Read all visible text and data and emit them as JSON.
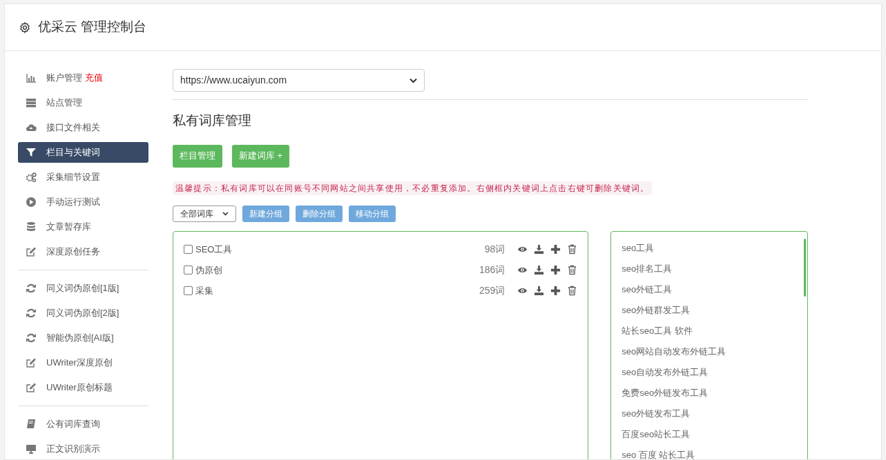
{
  "header": {
    "title": "优采云 管理控制台"
  },
  "sidebar": {
    "sections": [
      {
        "items": [
          {
            "label": "账户管理",
            "badge": "充值",
            "kind": "chart",
            "selected": false
          },
          {
            "label": "站点管理",
            "kind": "server",
            "selected": false
          },
          {
            "label": "接口文件相关",
            "kind": "cloud",
            "selected": false
          },
          {
            "label": "栏目与关键词",
            "kind": "filter",
            "selected": true
          },
          {
            "label": "采集细节设置",
            "kind": "gears",
            "selected": false
          },
          {
            "label": "手动运行测试",
            "kind": "play",
            "selected": false
          },
          {
            "label": "文章暂存库",
            "kind": "database",
            "selected": false
          },
          {
            "label": "深度原创任务",
            "kind": "edit",
            "selected": false
          }
        ]
      },
      {
        "items": [
          {
            "label": "同义词伪原创[1版]",
            "kind": "refresh",
            "selected": false
          },
          {
            "label": "同义词伪原创[2版]",
            "kind": "refresh",
            "selected": false
          },
          {
            "label": "智能伪原创[AI版]",
            "kind": "refresh",
            "selected": false
          },
          {
            "label": "UWriter深度原创",
            "kind": "edit",
            "selected": false
          },
          {
            "label": "UWriter原创标题",
            "kind": "edit",
            "selected": false
          }
        ]
      },
      {
        "items": [
          {
            "label": "公有词库查询",
            "kind": "book",
            "selected": false
          },
          {
            "label": "正文识别演示",
            "kind": "monitor",
            "selected": false
          }
        ]
      }
    ]
  },
  "site_select": {
    "value": "https://www.ucaiyun.com"
  },
  "heading": "私有词库管理",
  "action_buttons": [
    "栏目管理",
    "新建词库 +"
  ],
  "tip": "温馨提示：私有词库可以在同账号不同网站之间共享使用，不必重复添加。右侧框内关键词上点击右键可删除关键词。",
  "group_select": {
    "value": "全部词库"
  },
  "group_buttons": [
    "新建分组",
    "删除分组",
    "移动分组"
  ],
  "libraries": [
    {
      "name": "SEO工具",
      "count": "98词",
      "checked": false
    },
    {
      "name": "伪原创",
      "count": "186词",
      "checked": false
    },
    {
      "name": "采集",
      "count": "259词",
      "checked": false
    }
  ],
  "keywords": [
    "seo工具",
    "seo排名工具",
    "seo外链工具",
    "seo外链群发工具",
    "站长seo工具 软件",
    "seo网站自动发布外链工具",
    "seo自动发布外链工具",
    "免费seo外链发布工具",
    "seo外链发布工具",
    "百度seo站长工具",
    "seo 百度 站长工具"
  ]
}
